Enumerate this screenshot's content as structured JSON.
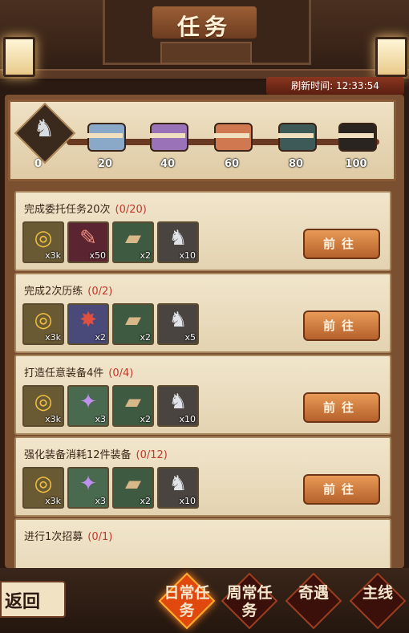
{
  "header": {
    "title": "任务"
  },
  "refresh": {
    "label": "刷新时间:",
    "time": "12:33:54"
  },
  "progress": {
    "start_value": "0",
    "milestones": [
      {
        "value": "20",
        "icon": "chest-blue-icon",
        "color": "#8aa8c8"
      },
      {
        "value": "40",
        "icon": "chest-purple-icon",
        "color": "#9a72b8"
      },
      {
        "value": "60",
        "icon": "chest-orange-icon",
        "color": "#d07850"
      },
      {
        "value": "80",
        "icon": "chest-teal-icon",
        "color": "#3e5a58"
      },
      {
        "value": "100",
        "icon": "chest-black-gold-icon",
        "color": "#2a2420"
      }
    ]
  },
  "tasks": [
    {
      "title": "完成委托任务20次",
      "count": "(0/20)",
      "action": "前往",
      "rewards": [
        {
          "icon": "coin-icon",
          "qty": "x3k"
        },
        {
          "icon": "scroll-icon",
          "qty": "x50"
        },
        {
          "icon": "book-icon",
          "qty": "x2"
        },
        {
          "icon": "horse-icon",
          "qty": "x10"
        }
      ]
    },
    {
      "title": "完成2次历练",
      "count": "(0/2)",
      "action": "前往",
      "rewards": [
        {
          "icon": "coin-icon",
          "qty": "x3k"
        },
        {
          "icon": "firecracker-icon",
          "qty": "x2"
        },
        {
          "icon": "book-icon",
          "qty": "x2"
        },
        {
          "icon": "horse-icon",
          "qty": "x5"
        }
      ]
    },
    {
      "title": "打造任意装备4件",
      "count": "(0/4)",
      "action": "前往",
      "rewards": [
        {
          "icon": "coin-icon",
          "qty": "x3k"
        },
        {
          "icon": "crystal-star-icon",
          "qty": "x3"
        },
        {
          "icon": "book-icon",
          "qty": "x2"
        },
        {
          "icon": "horse-icon",
          "qty": "x10"
        }
      ]
    },
    {
      "title": "强化装备消耗12件装备",
      "count": "(0/12)",
      "action": "前往",
      "rewards": [
        {
          "icon": "coin-icon",
          "qty": "x3k"
        },
        {
          "icon": "crystal-star-icon",
          "qty": "x3"
        },
        {
          "icon": "book-icon",
          "qty": "x2"
        },
        {
          "icon": "horse-icon",
          "qty": "x10"
        }
      ]
    },
    {
      "title": "进行1次招募",
      "count": "(0/1)",
      "action": "",
      "rewards": []
    }
  ],
  "nav": {
    "back": "返回",
    "tabs": [
      "日常任务",
      "周常任务",
      "奇遇",
      "主线"
    ]
  }
}
